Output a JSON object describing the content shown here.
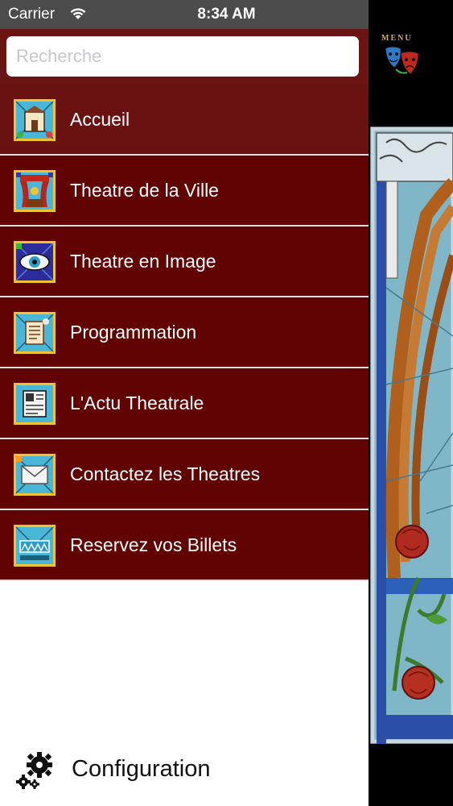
{
  "status_bar": {
    "carrier": "Carrier",
    "time": "8:34 AM",
    "wifi_icon": "wifi-icon"
  },
  "search": {
    "placeholder": "Recherche",
    "value": ""
  },
  "menu": {
    "items": [
      {
        "label": "Accueil",
        "icon": "home-stained-glass-icon"
      },
      {
        "label": "Theatre de la Ville",
        "icon": "stage-curtain-icon"
      },
      {
        "label": "Theatre en Image",
        "icon": "eye-icon"
      },
      {
        "label": "Programmation",
        "icon": "scroll-icon"
      },
      {
        "label": "L'Actu Theatrale",
        "icon": "newspaper-icon"
      },
      {
        "label": "Contactez les Theatres",
        "icon": "envelope-icon"
      },
      {
        "label": "Reservez vos Billets",
        "icon": "tickets-icon"
      }
    ]
  },
  "config": {
    "label": "Configuration",
    "icon": "gears-icon"
  },
  "right_panel": {
    "menu_button_text": "MENU",
    "menu_button_icon": "theatre-masks-icon",
    "background_image": "stained-glass-window"
  },
  "colors": {
    "menu_bg": "#610303",
    "menu_bg_first": "#6a1212",
    "search_bar_bg": "#6b1414",
    "separator": "#e9e3e3",
    "status_bar_bg": "#4b4b4b"
  }
}
